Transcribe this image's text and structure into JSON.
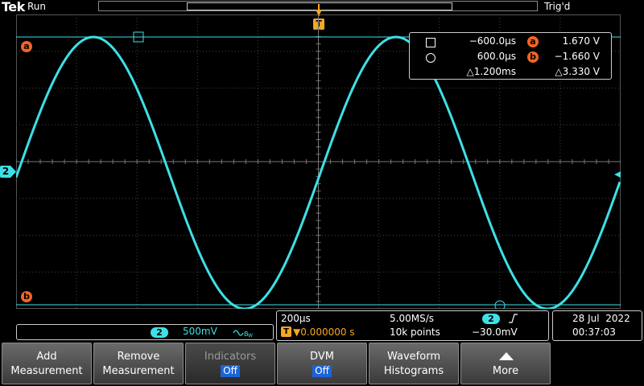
{
  "header": {
    "brand": "Tek",
    "run_state": "Run",
    "trigger_state": "Trig'd",
    "trigger_marker": "T"
  },
  "colors": {
    "trace": "#3ee0e6",
    "cursor_badge": "#f26522",
    "trigger": "#f5a623",
    "grid": "#444444",
    "button_pill": "#1b64d8"
  },
  "markers": {
    "channel": "2",
    "cursor_a": "a",
    "cursor_b": "b"
  },
  "cursor_readout": {
    "a_time": "−600.0µs",
    "a_volt": "1.670 V",
    "b_time": "600.0µs",
    "b_volt": "−1.660 V",
    "delta_time": "△1.200ms",
    "delta_volt": "△3.330 V",
    "a_label": "a",
    "b_label": "b"
  },
  "channel_info": {
    "number": "2",
    "scale": "500mV",
    "coupling_icon": "bandwidth-limit-icon"
  },
  "acquisition": {
    "timebase": "200µs",
    "sample_rate": "5.00MS/s",
    "trigger_source": "2",
    "trigger_slope_icon": "rising-edge-icon",
    "trigger_position_label": "T",
    "trigger_position": "▼0.000000 s",
    "record_length": "10k points",
    "trigger_level": "−30.0mV"
  },
  "datetime": {
    "date": "28 Jul  2022",
    "time": "00:37:03"
  },
  "buttons": [
    {
      "line1": "Add",
      "line2": "Measurement"
    },
    {
      "line1": "Remove",
      "line2": "Measurement"
    },
    {
      "line1": "Indicators",
      "line2": "Off"
    },
    {
      "line1": "DVM",
      "line2": "Off"
    },
    {
      "line1": "Waveform",
      "line2": "Histograms"
    },
    {
      "line1": "",
      "line2": "More"
    }
  ]
}
